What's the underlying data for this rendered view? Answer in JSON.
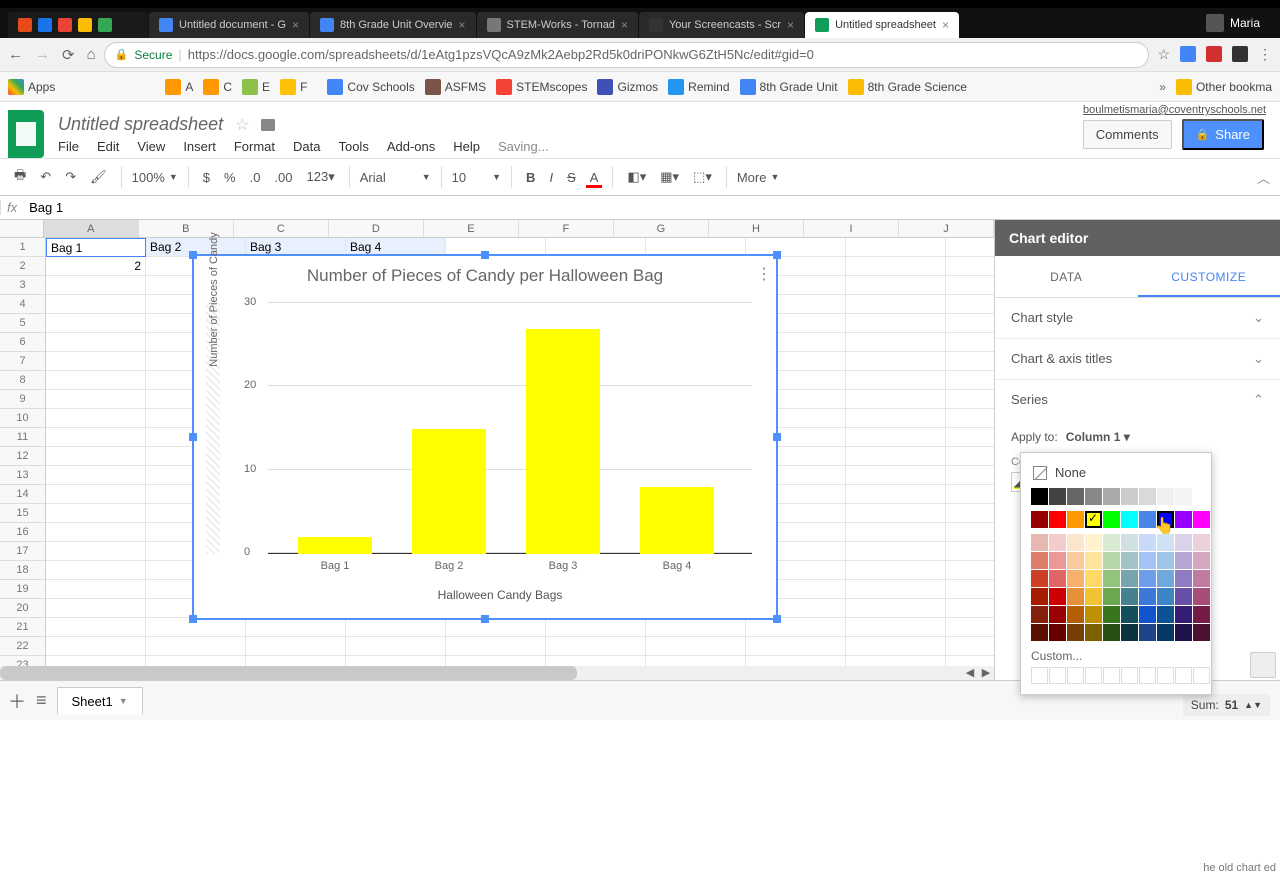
{
  "browser": {
    "profile_name": "Maria",
    "tabs": [
      {
        "label": "",
        "favicons": 5
      },
      {
        "label": "Untitled document - G",
        "color": "#4285f4"
      },
      {
        "label": "8th Grade Unit Overvie",
        "color": "#4285f4"
      },
      {
        "label": "STEM-Works - Tornad",
        "color": "#777"
      },
      {
        "label": "Your Screencasts - Scr",
        "color": "#333"
      },
      {
        "label": "Untitled spreadsheet",
        "color": "#0f9d58",
        "active": true
      }
    ],
    "secure_label": "Secure",
    "url": "https://docs.google.com/spreadsheets/d/1eAtg1pzsVQcA9zMk2Aebp2Rd5k0driPONkwG6ZtH5Nc/edit#gid=0",
    "other_bookmarks": "Other bookma"
  },
  "bookmarks": [
    {
      "label": "Apps"
    },
    {
      "label": ""
    },
    {
      "label": ""
    },
    {
      "label": ""
    },
    {
      "label": ""
    },
    {
      "label": ""
    },
    {
      "label": ""
    },
    {
      "label": ""
    },
    {
      "label": ""
    },
    {
      "label": ""
    },
    {
      "label": ""
    },
    {
      "label": "A"
    },
    {
      "label": "C"
    },
    {
      "label": "E"
    },
    {
      "label": "F"
    },
    {
      "label": ""
    },
    {
      "label": "Cov Schools"
    },
    {
      "label": "ASFMS"
    },
    {
      "label": "STEMscopes"
    },
    {
      "label": "Gizmos"
    },
    {
      "label": "Remind"
    },
    {
      "label": "8th Grade Unit"
    },
    {
      "label": "8th Grade Science"
    }
  ],
  "doc": {
    "title": "Untitled spreadsheet",
    "email": "boulmetismaria@coventryschools.net",
    "menus": [
      "File",
      "Edit",
      "View",
      "Insert",
      "Format",
      "Data",
      "Tools",
      "Add-ons",
      "Help"
    ],
    "saving": "Saving...",
    "comments": "Comments",
    "share": "Share"
  },
  "toolbar": {
    "zoom": "100%",
    "font": "Arial",
    "fontsize": "10",
    "more": "More"
  },
  "formula": {
    "namebox": "fx",
    "value": "Bag 1"
  },
  "grid": {
    "cols": [
      "A",
      "B",
      "C",
      "D",
      "E",
      "F",
      "G",
      "H",
      "I",
      "J"
    ],
    "row1": [
      "Bag 1",
      "Bag 2",
      "Bag 3",
      "Bag 4"
    ],
    "a2": "2"
  },
  "chart_data": {
    "type": "bar",
    "title": "Number of Pieces of Candy per Halloween Bag",
    "xlabel": "Halloween Candy Bags",
    "ylabel": "Number of Pieces of Candy",
    "categories": [
      "Bag 1",
      "Bag 2",
      "Bag 3",
      "Bag 4"
    ],
    "values": [
      2,
      15,
      27,
      8
    ],
    "ylim": [
      0,
      30
    ],
    "yticks": [
      0,
      10,
      20,
      30
    ],
    "bar_color": "#ffff00"
  },
  "editor": {
    "title": "Chart editor",
    "tab_data": "DATA",
    "tab_customize": "CUSTOMIZE",
    "sections": {
      "style": "Chart style",
      "axis": "Chart & axis titles",
      "series": "Series"
    },
    "apply_label": "Apply to:",
    "apply_value": "Column 1",
    "color_label": "Color",
    "none": "None",
    "custom": "Custom...",
    "oldchart": "he old chart ed"
  },
  "palette": {
    "row_gray": [
      "#000000",
      "#434343",
      "#666666",
      "#888888",
      "#aaaaaa",
      "#cccccc",
      "#d9d9d9",
      "#efefef",
      "#f3f3f3",
      "#ffffff"
    ],
    "row_sat": [
      "#980000",
      "#ff0000",
      "#ff9900",
      "#ffff00",
      "#00ff00",
      "#00ffff",
      "#4a86e8",
      "#0000ff",
      "#9900ff",
      "#ff00ff"
    ],
    "shades": [
      [
        "#e6b8af",
        "#f4cccc",
        "#fce5cd",
        "#fff2cc",
        "#d9ead3",
        "#d0e0e3",
        "#c9daf8",
        "#cfe2f3",
        "#d9d2e9",
        "#ead1dc"
      ],
      [
        "#dd7e6b",
        "#ea9999",
        "#f9cb9c",
        "#ffe599",
        "#b6d7a8",
        "#a2c4c9",
        "#a4c2f4",
        "#9fc5e8",
        "#b4a7d6",
        "#d5a6bd"
      ],
      [
        "#cc4125",
        "#e06666",
        "#f6b26b",
        "#ffd966",
        "#93c47d",
        "#76a5af",
        "#6d9eeb",
        "#6fa8dc",
        "#8e7cc3",
        "#c27ba0"
      ],
      [
        "#a61c00",
        "#cc0000",
        "#e69138",
        "#f1c232",
        "#6aa84f",
        "#45818e",
        "#3c78d8",
        "#3d85c6",
        "#674ea7",
        "#a64d79"
      ],
      [
        "#85200c",
        "#990000",
        "#b45f06",
        "#bf9000",
        "#38761d",
        "#134f5c",
        "#1155cc",
        "#0b5394",
        "#351c75",
        "#741b47"
      ],
      [
        "#5b0f00",
        "#660000",
        "#783f04",
        "#7f6000",
        "#274e13",
        "#0c343d",
        "#1c4587",
        "#073763",
        "#20124d",
        "#4c1130"
      ]
    ]
  },
  "sheetbar": {
    "sheet1": "Sheet1",
    "sum_label": "Sum:",
    "sum_value": "51"
  }
}
